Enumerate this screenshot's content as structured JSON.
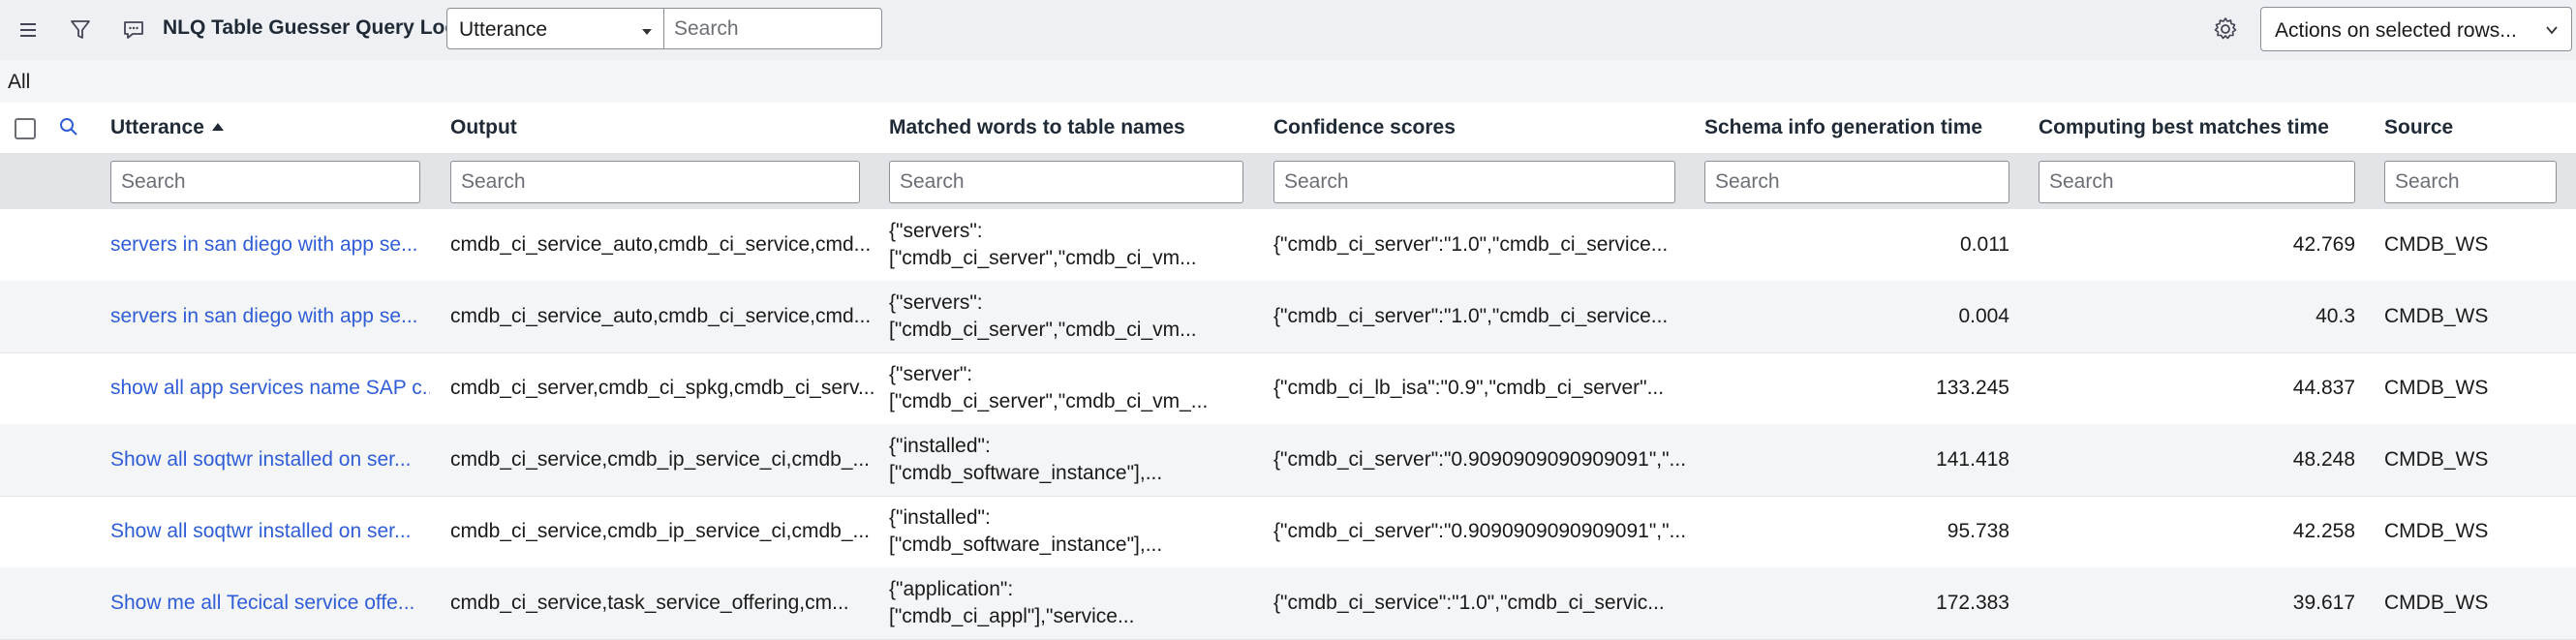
{
  "header": {
    "title": "NLQ Table Guesser Query Logs",
    "field_select_value": "Utterance",
    "search_placeholder": "Search",
    "actions_label": "Actions on selected rows...",
    "icons": [
      "menu-icon",
      "filter-icon",
      "chat-icon",
      "gear-icon",
      "chevron-down-icon"
    ]
  },
  "breadcrumb": "All",
  "table": {
    "columns": [
      {
        "label": "Utterance",
        "sorted": "ascending"
      },
      {
        "label": "Output"
      },
      {
        "label": "Matched words to table names"
      },
      {
        "label": "Confidence scores"
      },
      {
        "label": "Schema info generation time"
      },
      {
        "label": "Computing best matches time"
      },
      {
        "label": "Source"
      }
    ],
    "search_placeholder": "Search",
    "rows": [
      {
        "utterance": "servers in san diego with app se...",
        "output": "cmdb_ci_service_auto,cmdb_ci_service,cmd...",
        "matched_line1": "{\"servers\":",
        "matched_line2": "[\"cmdb_ci_server\",\"cmdb_ci_vm...",
        "confidence": "{\"cmdb_ci_server\":\"1.0\",\"cmdb_ci_service...",
        "schema_time": "0.011",
        "matches_time": "42.769",
        "source": "CMDB_WS"
      },
      {
        "utterance": "servers in san diego with app se...",
        "output": "cmdb_ci_service_auto,cmdb_ci_service,cmd...",
        "matched_line1": "{\"servers\":",
        "matched_line2": "[\"cmdb_ci_server\",\"cmdb_ci_vm...",
        "confidence": "{\"cmdb_ci_server\":\"1.0\",\"cmdb_ci_service...",
        "schema_time": "0.004",
        "matches_time": "40.3",
        "source": "CMDB_WS"
      },
      {
        "utterance": "show all app services name SAP c...",
        "output": "cmdb_ci_server,cmdb_ci_spkg,cmdb_ci_serv...",
        "matched_line1": "{\"server\":",
        "matched_line2": "[\"cmdb_ci_server\",\"cmdb_ci_vm_...",
        "confidence": "{\"cmdb_ci_lb_isa\":\"0.9\",\"cmdb_ci_server\"...",
        "schema_time": "133.245",
        "matches_time": "44.837",
        "source": "CMDB_WS"
      },
      {
        "utterance": "Show all soqtwr installed on ser...",
        "output": "cmdb_ci_service,cmdb_ip_service_ci,cmdb_...",
        "matched_line1": "{\"installed\":",
        "matched_line2": "[\"cmdb_software_instance\"],...",
        "confidence": "{\"cmdb_ci_server\":\"0.9090909090909091\",\"...",
        "schema_time": "141.418",
        "matches_time": "48.248",
        "source": "CMDB_WS"
      },
      {
        "utterance": "Show all soqtwr installed on ser...",
        "output": "cmdb_ci_service,cmdb_ip_service_ci,cmdb_...",
        "matched_line1": "{\"installed\":",
        "matched_line2": "[\"cmdb_software_instance\"],...",
        "confidence": "{\"cmdb_ci_server\":\"0.9090909090909091\",\"...",
        "schema_time": "95.738",
        "matches_time": "42.258",
        "source": "CMDB_WS"
      },
      {
        "utterance": "Show me all Tecical service offe...",
        "output": "cmdb_ci_service,task_service_offering,cm...",
        "matched_line1": "{\"application\":",
        "matched_line2": "[\"cmdb_ci_appl\"],\"service...",
        "confidence": "{\"cmdb_ci_service\":\"1.0\",\"cmdb_ci_servic...",
        "schema_time": "172.383",
        "matches_time": "39.617",
        "source": "CMDB_WS"
      }
    ]
  },
  "colors": {
    "link": "#2f5dd7",
    "header_bg": "#eef0f3",
    "alt_row_bg": "#f4f5f7",
    "search_row_bg": "#e2e4e7"
  }
}
